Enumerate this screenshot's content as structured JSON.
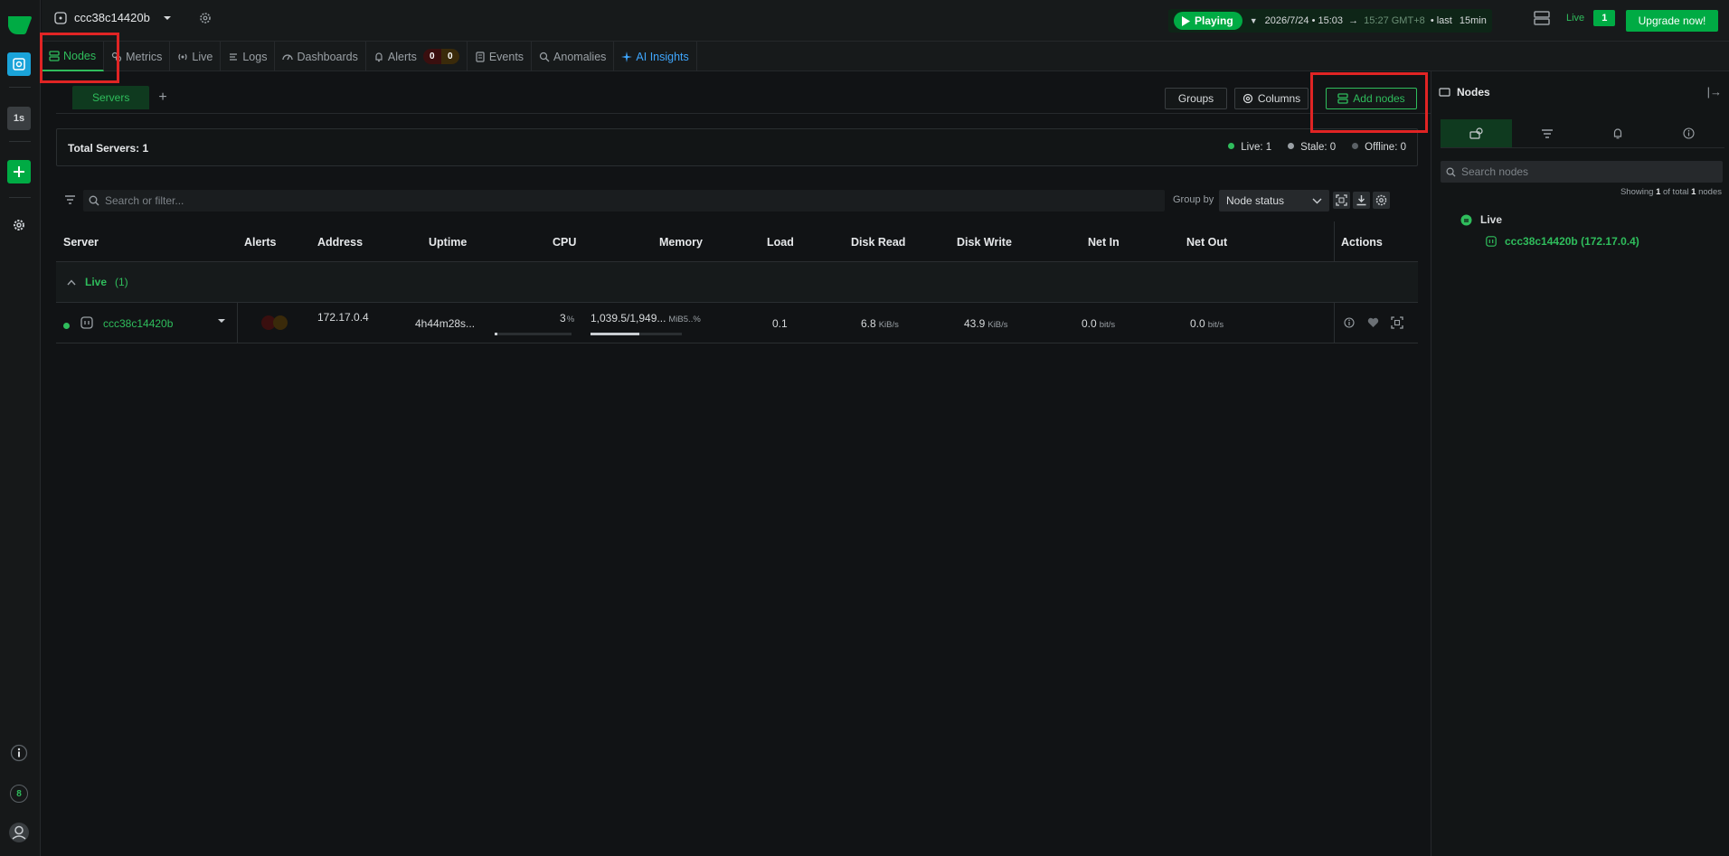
{
  "topbar": {
    "node_name": "ccc38c14420b",
    "play_label": "Playing",
    "date_start": "2026/7/24 • 15:03",
    "arrow": "→",
    "date_end": "15:27 GMT+8",
    "last_label": "• last",
    "duration": "15min",
    "live_label": "Live",
    "live_count": "1",
    "upgrade_label": "Upgrade now!"
  },
  "rail": {
    "badge_1s": "1s",
    "notif_count": "8"
  },
  "tabs": [
    {
      "label": "Nodes",
      "icon": "nodes-icon",
      "active": true
    },
    {
      "label": "Metrics",
      "icon": "metrics-icon"
    },
    {
      "label": "Live",
      "icon": "live-icon"
    },
    {
      "label": "Logs",
      "icon": "logs-icon"
    },
    {
      "label": "Dashboards",
      "icon": "dashboards-icon"
    },
    {
      "label": "Alerts",
      "icon": "bell-icon",
      "badges": [
        "0",
        "0"
      ]
    },
    {
      "label": "Events",
      "icon": "events-icon"
    },
    {
      "label": "Anomalies",
      "icon": "anomalies-icon"
    },
    {
      "label": "AI Insights",
      "icon": "sparkle-icon"
    }
  ],
  "main": {
    "subtab_label": "Servers",
    "add_tab": "+",
    "groups_label": "Groups",
    "columns_label": "Columns",
    "add_nodes_label": "Add nodes",
    "summary_title": "Total Servers: 1",
    "stat_live": "Live: 1",
    "stat_stale": "Stale: 0",
    "stat_offline": "Offline: 0",
    "search_placeholder": "Search or filter...",
    "groupby_label": "Group by",
    "groupby_value": "Node status"
  },
  "table": {
    "headers": [
      "Server",
      "Alerts",
      "Address",
      "Uptime",
      "CPU",
      "Memory",
      "Load",
      "Disk Read",
      "Disk Write",
      "Net In",
      "Net Out",
      "Actions"
    ],
    "group": {
      "label": "Live",
      "count": "(1)"
    },
    "rows": [
      {
        "server": "ccc38c14420b",
        "address": "172.17.0.4",
        "uptime": "4h44m28s...",
        "cpu": "3",
        "cpu_unit": "%",
        "cpu_fraction": 0.03,
        "memory": "1,039.5/1,949...",
        "memory_unit": "MiB5..%",
        "memory_fraction": 0.53,
        "load": "0.1",
        "disk_read": "6.8",
        "disk_read_unit": "KiB/s",
        "disk_write": "43.9",
        "disk_write_unit": "KiB/s",
        "net_in": "0.0",
        "net_in_unit": "bit/s",
        "net_out": "0.0",
        "net_out_unit": "bit/s"
      }
    ]
  },
  "right_panel": {
    "title": "Nodes",
    "collapse": "|→",
    "search_placeholder": "Search nodes",
    "showing_pre": "Showing",
    "showing_n": "1",
    "showing_mid": "of total",
    "showing_total": "1",
    "showing_post": "nodes",
    "group_label": "Live",
    "node_label": "ccc38c14420b (172.17.0.4)"
  },
  "colors": {
    "accent": "#00ab44",
    "accent_text": "#2fbd5c",
    "ai": "#3fa7ff",
    "highlight": "#e02424",
    "background": "#111315"
  }
}
